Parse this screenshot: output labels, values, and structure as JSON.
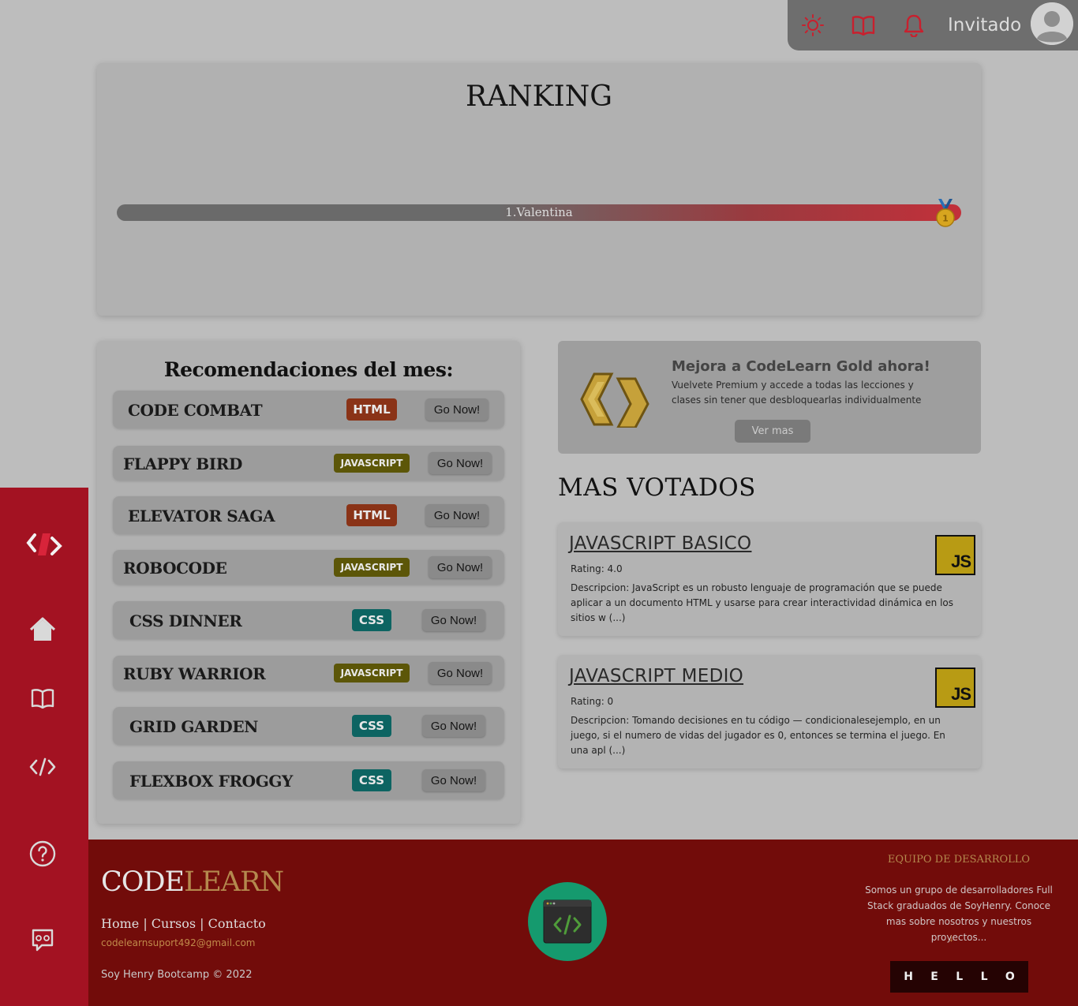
{
  "topbar": {
    "user_name": "Invitado",
    "icons": [
      "sun-icon",
      "book-icon",
      "bell-icon",
      "avatar"
    ]
  },
  "ranking": {
    "title": "RANKING",
    "entries": [
      {
        "label": "1.Valentina",
        "progress": 1.0
      }
    ]
  },
  "recommendations": {
    "title": "Recomendaciones del mes:",
    "go_label": "Go Now!",
    "items": [
      {
        "name": "CODE COMBAT",
        "tag": "HTML"
      },
      {
        "name": "FLAPPY BIRD",
        "tag": "JAVASCRIPT"
      },
      {
        "name": "ELEVATOR SAGA",
        "tag": "HTML"
      },
      {
        "name": "ROBOCODE",
        "tag": "JAVASCRIPT"
      },
      {
        "name": "CSS DINNER",
        "tag": "CSS"
      },
      {
        "name": "RUBY WARRIOR",
        "tag": "JAVASCRIPT"
      },
      {
        "name": "GRID GARDEN",
        "tag": "CSS"
      },
      {
        "name": "FLEXBOX FROGGY",
        "tag": "CSS"
      }
    ],
    "tag_colors": {
      "HTML": "#8a3317",
      "JAVASCRIPT": "#5c5608",
      "CSS": "#0d6462"
    }
  },
  "gold": {
    "title": "Mejora a CodeLearn Gold ahora!",
    "text": "Vuelvete Premium y accede a todas las lecciones y clases sin tener que desbloquearlas individualmente",
    "button": "Ver mas"
  },
  "mas_votados": {
    "title": "MAS VOTADOS",
    "courses": [
      {
        "title": "JAVASCRIPT BASICO",
        "rating": "Rating: 4.0",
        "logo": "JS",
        "desc": "Descripcion: JavaScript es un robusto lenguaje de programación que se puede aplicar a un documento HTML y usarse para crear interactividad dinámica en los sitios w (...)"
      },
      {
        "title": "JAVASCRIPT MEDIO",
        "rating": "Rating: 0",
        "logo": "JS",
        "desc": "Descripcion: Tomando decisiones en tu código — condicionalesejemplo, en un juego, si el numero de vidas del jugador es 0, entonces se termina el juego. En una apl (...)"
      }
    ]
  },
  "sidebar": {
    "items": [
      "logo-icon",
      "home-icon",
      "book-icon",
      "code-icon",
      "help-icon",
      "chat-icon"
    ]
  },
  "footer": {
    "logo_part1": "CODE",
    "logo_part2": "LEARN",
    "link_home": "Home",
    "sep1": " | ",
    "link_cursos": "Cursos",
    "sep2": " | ",
    "link_contacto": "Contacto",
    "email": "codelearnsuport492@gmail.com",
    "copyright": "Soy Henry Bootcamp © 2022",
    "team_title": "EQUIPO DE DESARROLLO",
    "team_text": "Somos un grupo de desarrolladores Full Stack graduados de SoyHenry. Conoce mas sobre nosotros y nuestros proyectos...",
    "arrow": "↓",
    "hello": [
      "H",
      "E",
      "L",
      "L",
      "O"
    ]
  },
  "colors": {
    "accent": "#a31222",
    "footer": "#720c0a",
    "logo_first": "#e6e6e6",
    "logo_second": "#b4894e"
  }
}
